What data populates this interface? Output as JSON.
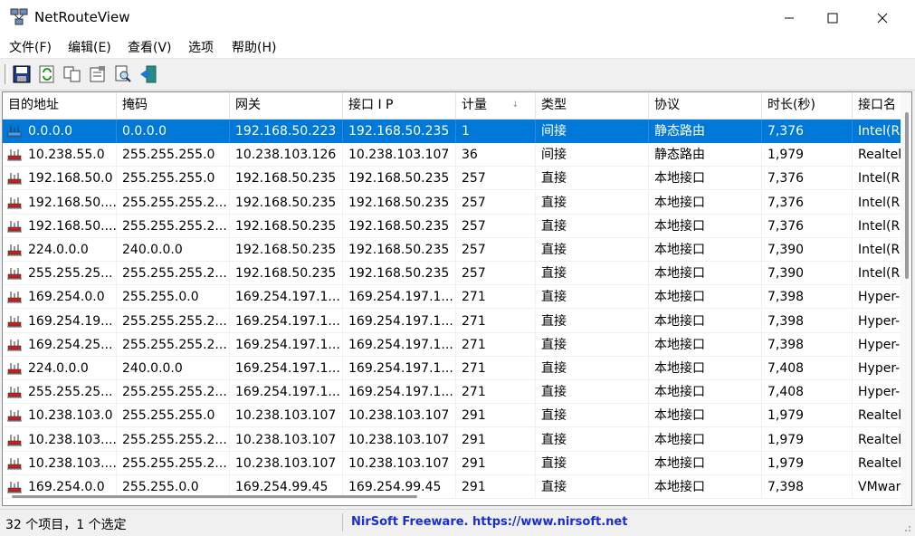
{
  "window": {
    "title": "NetRouteView"
  },
  "menu": [
    {
      "label": "文件(F)"
    },
    {
      "label": "编辑(E)"
    },
    {
      "label": "查看(V)"
    },
    {
      "label": "选项"
    },
    {
      "label": "帮助(H)"
    }
  ],
  "toolbar": {
    "buttons": [
      {
        "name": "save-icon"
      },
      {
        "name": "refresh-icon"
      },
      {
        "name": "copy-icon"
      },
      {
        "name": "properties-icon"
      },
      {
        "name": "find-icon"
      },
      {
        "name": "exit-icon"
      }
    ]
  },
  "columns": [
    {
      "label": "目的地址"
    },
    {
      "label": "掩码"
    },
    {
      "label": "网关"
    },
    {
      "label": "接口 I P"
    },
    {
      "label": "计量"
    },
    {
      "label": "类型"
    },
    {
      "label": "协议"
    },
    {
      "label": "时长(秒)"
    },
    {
      "label": "接口名"
    }
  ],
  "sort_indicator": "↓",
  "rows": [
    {
      "c": [
        "0.0.0.0",
        "0.0.0.0",
        "192.168.50.223",
        "192.168.50.235",
        "1",
        "间接",
        "静态路由",
        "7,376",
        "Intel(R"
      ],
      "selected": true
    },
    {
      "c": [
        "10.238.55.0",
        "255.255.255.0",
        "10.238.103.126",
        "10.238.103.107",
        "36",
        "间接",
        "静态路由",
        "1,979",
        "Realtek"
      ]
    },
    {
      "c": [
        "192.168.50.0",
        "255.255.255.0",
        "192.168.50.235",
        "192.168.50.235",
        "257",
        "直接",
        "本地接口",
        "7,376",
        "Intel(R"
      ]
    },
    {
      "c": [
        "192.168.50....",
        "255.255.255.2...",
        "192.168.50.235",
        "192.168.50.235",
        "257",
        "直接",
        "本地接口",
        "7,376",
        "Intel(R"
      ]
    },
    {
      "c": [
        "192.168.50....",
        "255.255.255.2...",
        "192.168.50.235",
        "192.168.50.235",
        "257",
        "直接",
        "本地接口",
        "7,376",
        "Intel(R"
      ]
    },
    {
      "c": [
        "224.0.0.0",
        "240.0.0.0",
        "192.168.50.235",
        "192.168.50.235",
        "257",
        "直接",
        "本地接口",
        "7,390",
        "Intel(R"
      ]
    },
    {
      "c": [
        "255.255.25...",
        "255.255.255.2...",
        "192.168.50.235",
        "192.168.50.235",
        "257",
        "直接",
        "本地接口",
        "7,390",
        "Intel(R"
      ]
    },
    {
      "c": [
        "169.254.0.0",
        "255.255.0.0",
        "169.254.197.1...",
        "169.254.197.1...",
        "271",
        "直接",
        "本地接口",
        "7,398",
        "Hyper-"
      ]
    },
    {
      "c": [
        "169.254.19...",
        "255.255.255.2...",
        "169.254.197.1...",
        "169.254.197.1...",
        "271",
        "直接",
        "本地接口",
        "7,398",
        "Hyper-"
      ]
    },
    {
      "c": [
        "169.254.25...",
        "255.255.255.2...",
        "169.254.197.1...",
        "169.254.197.1...",
        "271",
        "直接",
        "本地接口",
        "7,398",
        "Hyper-"
      ]
    },
    {
      "c": [
        "224.0.0.0",
        "240.0.0.0",
        "169.254.197.1...",
        "169.254.197.1...",
        "271",
        "直接",
        "本地接口",
        "7,408",
        "Hyper-"
      ]
    },
    {
      "c": [
        "255.255.25...",
        "255.255.255.2...",
        "169.254.197.1...",
        "169.254.197.1...",
        "271",
        "直接",
        "本地接口",
        "7,408",
        "Hyper-"
      ]
    },
    {
      "c": [
        "10.238.103.0",
        "255.255.255.0",
        "10.238.103.107",
        "10.238.103.107",
        "291",
        "直接",
        "本地接口",
        "1,979",
        "Realtek"
      ]
    },
    {
      "c": [
        "10.238.103....",
        "255.255.255.2...",
        "10.238.103.107",
        "10.238.103.107",
        "291",
        "直接",
        "本地接口",
        "1,979",
        "Realtek"
      ]
    },
    {
      "c": [
        "10.238.103....",
        "255.255.255.2...",
        "10.238.103.107",
        "10.238.103.107",
        "291",
        "直接",
        "本地接口",
        "1,979",
        "Realtek"
      ]
    },
    {
      "c": [
        "169.254.0.0",
        "255.255.0.0",
        "169.254.99.45",
        "169.254.99.45",
        "291",
        "直接",
        "本地接口",
        "7,398",
        "VMwar"
      ]
    }
  ],
  "status": {
    "left": "32 个项目，1 个选定",
    "right": "NirSoft Freeware. https://www.nirsoft.net"
  },
  "colors": {
    "selection": "#0078d7",
    "link": "#1a2fd0"
  }
}
